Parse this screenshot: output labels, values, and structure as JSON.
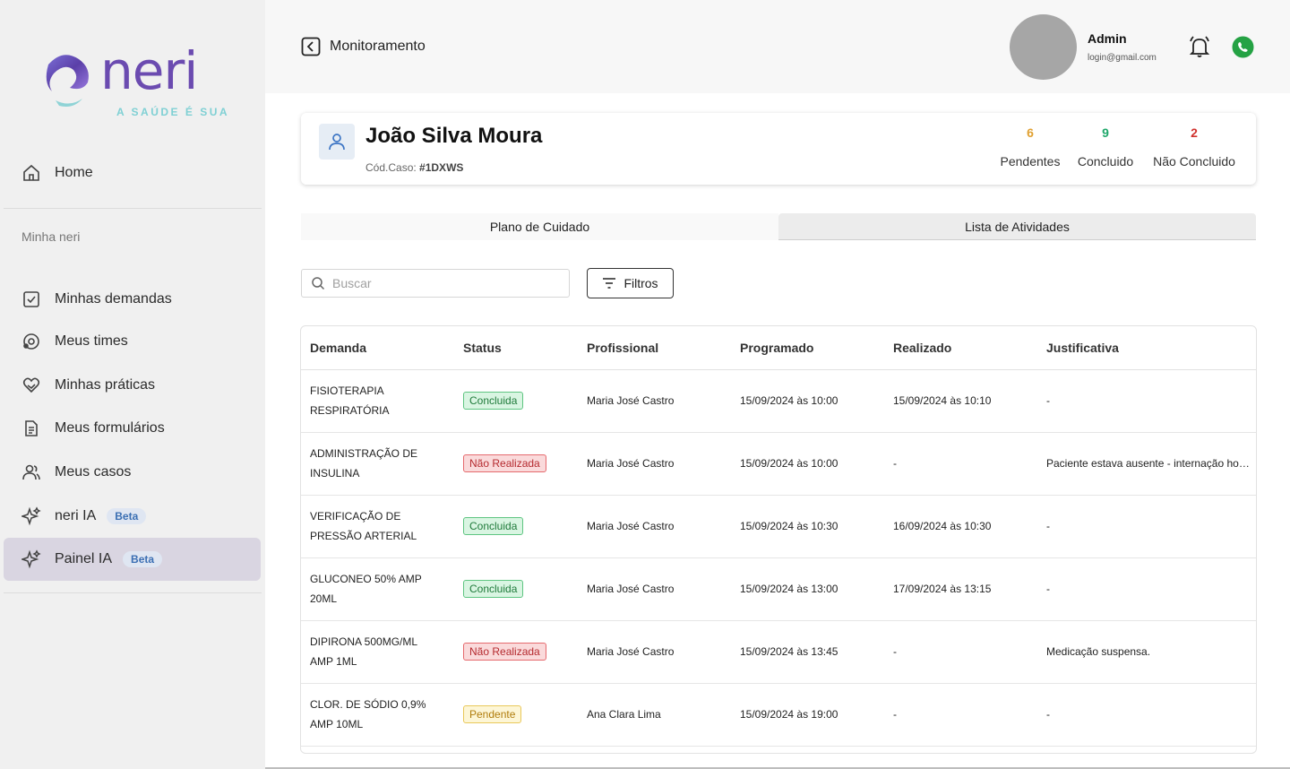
{
  "sidebar": {
    "logo": {
      "word": "neri",
      "tagline": "A SAÚDE É SUA"
    },
    "home": {
      "label": "Home",
      "icon": "home-icon"
    },
    "section_label": "Minha neri",
    "items": [
      {
        "label": "Minhas demandas",
        "icon": "checklist-icon"
      },
      {
        "label": "Meus times",
        "icon": "team-icon"
      },
      {
        "label": "Minhas práticas",
        "icon": "heart-hands-icon"
      },
      {
        "label": "Meus formulários",
        "icon": "document-icon"
      },
      {
        "label": "Meus casos",
        "icon": "users-icon"
      },
      {
        "label": "neri IA",
        "icon": "sparkle-icon",
        "badge": "Beta"
      },
      {
        "label": "Painel IA",
        "icon": "sparkle-icon",
        "badge": "Beta",
        "active": true
      }
    ]
  },
  "header": {
    "breadcrumb": "Monitoramento",
    "user": {
      "name": "Admin",
      "email": "login@gmail.com"
    }
  },
  "case": {
    "name": "João Silva Moura",
    "code_label": "Cód.Caso:",
    "code": "#1DXWS",
    "stats": [
      {
        "value": "6",
        "label": "Pendentes",
        "color": "#e0a030"
      },
      {
        "value": "9",
        "label": "Concluido",
        "color": "#1ea76a"
      },
      {
        "value": "2",
        "label": "Não Concluido",
        "color": "#d0312d"
      }
    ]
  },
  "tabs": [
    {
      "label": "Plano de Cuidado"
    },
    {
      "label": "Lista de Atividades",
      "active": true
    }
  ],
  "search": {
    "placeholder": "Buscar"
  },
  "filter_button": "Filtros",
  "table": {
    "headers": [
      "Demanda",
      "Status",
      "Profissional",
      "Programado",
      "Realizado",
      "Justificativa"
    ],
    "rows": [
      {
        "demanda": "FISIOTERAPIA RESPIRATÓRIA",
        "status": "Concluida",
        "profissional": "Maria José Castro",
        "programado": "15/09/2024 às 10:00",
        "realizado": "15/09/2024 às 10:10",
        "justificativa": "-"
      },
      {
        "demanda": "ADMINISTRAÇÃO DE INSULINA",
        "status": "Não Realizada",
        "profissional": "Maria José Castro",
        "programado": "15/09/2024 às 10:00",
        "realizado": "-",
        "justificativa": "Paciente estava ausente - internação hospitalar"
      },
      {
        "demanda": "VERIFICAÇÃO DE PRESSÃO ARTERIAL",
        "status": "Concluida",
        "profissional": "Maria José Castro",
        "programado": "15/09/2024 às 10:30",
        "realizado": "16/09/2024 às 10:30",
        "justificativa": "-"
      },
      {
        "demanda": "GLUCONEO 50% AMP 20ML",
        "status": "Concluida",
        "profissional": "Maria José Castro",
        "programado": "15/09/2024 às 13:00",
        "realizado": "17/09/2024 às 13:15",
        "justificativa": "-"
      },
      {
        "demanda": "DIPIRONA 500MG/ML AMP 1ML",
        "status": "Não Realizada",
        "profissional": "Maria José Castro",
        "programado": "15/09/2024 às 13:45",
        "realizado": "-",
        "justificativa": "Medicação suspensa."
      },
      {
        "demanda": "CLOR. DE SÓDIO 0,9% AMP 10ML",
        "status": "Pendente",
        "profissional": "Ana Clara Lima",
        "programado": "15/09/2024 às 19:00",
        "realizado": "-",
        "justificativa": "-"
      }
    ]
  },
  "colors": {
    "accent": "#6b4bb0",
    "active_nav": "#d9d5e1",
    "whatsapp": "#25a244"
  }
}
